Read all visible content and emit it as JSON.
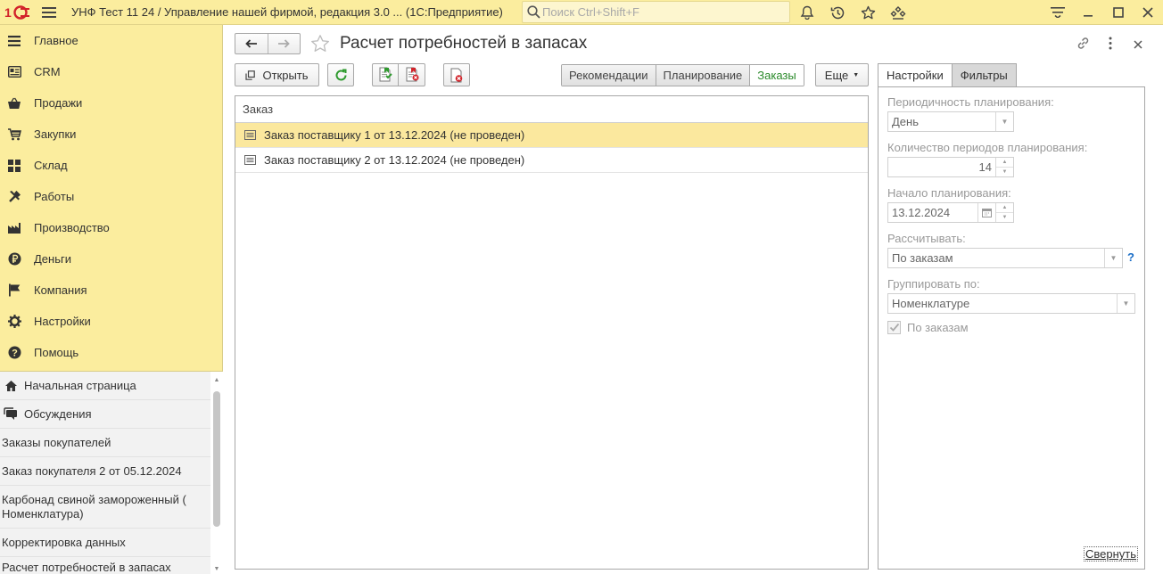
{
  "titlebar": {
    "app_title": "УНФ Тест 11 24 / Управление нашей фирмой, редакция 3.0 ...  (1С:Предприятие)",
    "search_placeholder": "Поиск Ctrl+Shift+F",
    "logo_icon": "1c-logo-icon",
    "logo_color": "#d2232a"
  },
  "sidebar": {
    "items": [
      {
        "label": "Главное",
        "icon": "menu-lines-icon"
      },
      {
        "label": "CRM",
        "icon": "crm-card-icon"
      },
      {
        "label": "Продажи",
        "icon": "basket-icon"
      },
      {
        "label": "Закупки",
        "icon": "cart-icon"
      },
      {
        "label": "Склад",
        "icon": "warehouse-grid-icon"
      },
      {
        "label": "Работы",
        "icon": "tools-icon"
      },
      {
        "label": "Производство",
        "icon": "factory-icon"
      },
      {
        "label": "Деньги",
        "icon": "ruble-coin-icon"
      },
      {
        "label": "Компания",
        "icon": "flag-icon"
      },
      {
        "label": "Настройки",
        "icon": "gear-icon"
      },
      {
        "label": "Помощь",
        "icon": "help-circle-icon"
      }
    ]
  },
  "history": {
    "items": [
      {
        "label": "Начальная страница",
        "icon": "home-icon"
      },
      {
        "label": "Обсуждения",
        "icon": "chat-icon"
      },
      {
        "label": "Заказы покупателей"
      },
      {
        "label": "Заказ покупателя 2 от 05.12.2024"
      },
      {
        "label": "Карбонад свиной замороженный ( Номенклатура)"
      },
      {
        "label": "Корректировка данных"
      },
      {
        "label": "Расчет потребностей в запасах"
      }
    ]
  },
  "main": {
    "title": "Расчет потребностей в запасах",
    "toolbar": {
      "open_label": "Открыть",
      "more_label": "Еще"
    },
    "modes": [
      {
        "label": "Рекомендации",
        "active": false
      },
      {
        "label": "Планирование",
        "active": false
      },
      {
        "label": "Заказы",
        "active": true
      }
    ],
    "accent_color": "#2a8a2a",
    "selection_color": "#fbe89e",
    "table": {
      "column_header": "Заказ",
      "rows": [
        {
          "text": "Заказ поставщику 1 от 13.12.2024 (не проведен)",
          "selected": true
        },
        {
          "text": "Заказ поставщику 2 от 13.12.2024 (не проведен)",
          "selected": false
        }
      ]
    }
  },
  "panel": {
    "tabs": [
      {
        "label": "Настройки",
        "active": true
      },
      {
        "label": "Фильтры",
        "active": false
      }
    ],
    "periodicity_label": "Периодичность планирования:",
    "periodicity_value": "День",
    "periods_count_label": "Количество периодов планирования:",
    "periods_count_value": "14",
    "start_label": "Начало планирования:",
    "start_value": "13.12.2024",
    "calc_label": "Рассчитывать:",
    "calc_value": "По заказам",
    "help_mark": "?",
    "group_label": "Группировать по:",
    "group_value": "Номенклатуре",
    "by_orders_label": "По заказам",
    "by_orders_checked": true,
    "collapse_label": "Свернуть"
  }
}
